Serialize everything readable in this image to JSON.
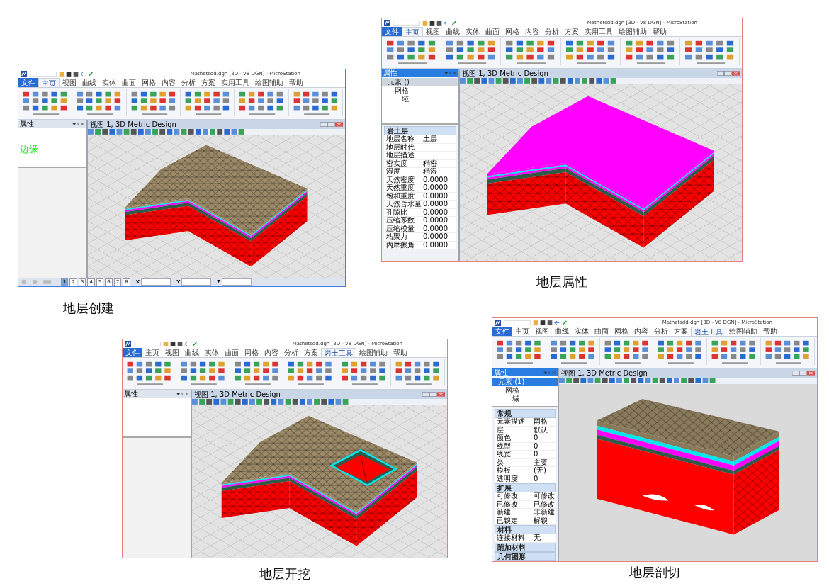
{
  "figures": [
    {
      "caption": "地层创建",
      "color": "#4a7de0",
      "window": {
        "title": "Mathetsdd.dgn [3D - V8 DGN] - MicroStation",
        "tabs": [
          {
            "label": "文件",
            "selected": false
          },
          {
            "label": "主页",
            "selected": true
          },
          {
            "label": "视图",
            "selected": false
          },
          {
            "label": "曲线",
            "selected": false
          },
          {
            "label": "实体",
            "selected": false
          },
          {
            "label": "曲面",
            "selected": false
          },
          {
            "label": "网格",
            "selected": false
          },
          {
            "label": "内容",
            "selected": false
          },
          {
            "label": "分析",
            "selected": false
          },
          {
            "label": "方案",
            "selected": false
          },
          {
            "label": "实用工具",
            "selected": false
          },
          {
            "label": "绘图辅助",
            "selected": false
          },
          {
            "label": "帮助",
            "selected": false
          }
        ],
        "sidebar": {
          "kind": "blank",
          "title": "属性",
          "edge_label": "边缘"
        },
        "view": {
          "title": "视图 1, 3D Metric Design",
          "kind": "build"
        },
        "status_bar": {
          "views": [
            {
              "label": "1",
              "selected": true
            },
            {
              "label": "2",
              "selected": false
            },
            {
              "label": "3",
              "selected": false
            },
            {
              "label": "4",
              "selected": false
            },
            {
              "label": "5",
              "selected": false
            },
            {
              "label": "6",
              "selected": false
            },
            {
              "label": "7",
              "selected": false
            },
            {
              "label": "8",
              "selected": false
            }
          ],
          "axes": [
            "X",
            "Y",
            "Z"
          ]
        }
      }
    },
    {
      "caption": "地层属性",
      "color": "#e88080",
      "window": {
        "title": "Mathetsdd.dgn [3D - V8 DGN] - MicroStation",
        "tabs": [
          {
            "label": "文件",
            "selected": false
          },
          {
            "label": "主页",
            "selected": true
          },
          {
            "label": "视图",
            "selected": false
          },
          {
            "label": "曲线",
            "selected": false
          },
          {
            "label": "实体",
            "selected": false
          },
          {
            "label": "曲面",
            "selected": false
          },
          {
            "label": "网格",
            "selected": false
          },
          {
            "label": "内容",
            "selected": false
          },
          {
            "label": "分析",
            "selected": false
          },
          {
            "label": "方案",
            "selected": false
          },
          {
            "label": "实用工具",
            "selected": false
          },
          {
            "label": "绘图辅助",
            "selected": false
          },
          {
            "label": "帮助",
            "selected": false
          }
        ],
        "sidebar": {
          "kind": "tree",
          "title": "属性",
          "tree": [
            {
              "label": "元素 ()",
              "selected": true,
              "children": [
                {
                  "label": "网格",
                  "selected": false,
                  "children": [
                    {
                      "label": "域",
                      "selected": false
                    }
                  ]
                }
              ]
            }
          ],
          "sections": [
            {
              "title": "岩土层",
              "expanded": true,
              "rows": [
                {
                  "label": "地层名称",
                  "value": "土层"
                },
                {
                  "label": "地层时代"
                },
                {
                  "label": "地层描述"
                },
                {
                  "label": "密实度",
                  "value": "稍密"
                },
                {
                  "label": "湿度",
                  "value": "稍湿"
                },
                {
                  "label": "天然密度",
                  "value": "0.0000"
                },
                {
                  "label": "天然重度",
                  "value": "0.0000"
                },
                {
                  "label": "饱和重度",
                  "value": "0.0000"
                },
                {
                  "label": "天然含水量",
                  "value": "0.0000"
                },
                {
                  "label": "孔隙比",
                  "value": "0.0000"
                },
                {
                  "label": "压缩系数",
                  "value": "0.0000"
                },
                {
                  "label": "压缩模量",
                  "value": "0.0000"
                },
                {
                  "label": "粘聚力",
                  "value": "0.0000"
                },
                {
                  "label": "内摩擦角",
                  "value": "0.0000"
                }
              ]
            }
          ]
        },
        "view": {
          "title": "视图 1, 3D Metric Design",
          "kind": "property"
        }
      }
    },
    {
      "caption": "地层开挖",
      "color": "#e88080",
      "window": {
        "title": "Mathetsdd.dgn [3D - V8 DGN] - MicroStation",
        "tabs": [
          {
            "label": "文件",
            "selected": false
          },
          {
            "label": "主页",
            "selected": false
          },
          {
            "label": "视图",
            "selected": false
          },
          {
            "label": "曲线",
            "selected": false
          },
          {
            "label": "实体",
            "selected": false
          },
          {
            "label": "曲面",
            "selected": false
          },
          {
            "label": "网格",
            "selected": false
          },
          {
            "label": "内容",
            "selected": false
          },
          {
            "label": "分析",
            "selected": false
          },
          {
            "label": "方案",
            "selected": false
          },
          {
            "label": "岩土工具",
            "selected": true
          },
          {
            "label": "绘图辅助",
            "selected": false
          },
          {
            "label": "帮助",
            "selected": false
          }
        ],
        "sidebar": {
          "kind": "blank",
          "title": "属性"
        },
        "view": {
          "title": "视图 1, 3D Metric Design",
          "kind": "excavation"
        }
      }
    },
    {
      "caption": "地层剖切",
      "color": "#e88080",
      "window": {
        "title": "Mathetsdd.dgn [3D - V8 DGN] - MicroStation",
        "tabs": [
          {
            "label": "文件",
            "selected": false
          },
          {
            "label": "主页",
            "selected": false
          },
          {
            "label": "视图",
            "selected": false
          },
          {
            "label": "曲线",
            "selected": false
          },
          {
            "label": "实体",
            "selected": false
          },
          {
            "label": "曲面",
            "selected": false
          },
          {
            "label": "网格",
            "selected": false
          },
          {
            "label": "内容",
            "selected": false
          },
          {
            "label": "分析",
            "selected": false
          },
          {
            "label": "方案",
            "selected": false
          },
          {
            "label": "岩土工具",
            "selected": true
          },
          {
            "label": "绘图辅助",
            "selected": false
          },
          {
            "label": "帮助",
            "selected": false
          }
        ],
        "sidebar": {
          "kind": "tree",
          "title": "属性",
          "tree": [
            {
              "label": "元素 (1)",
              "selected": true,
              "children": [
                {
                  "label": "网格",
                  "selected": false,
                  "children": [
                    {
                      "label": "域",
                      "selected": false
                    }
                  ]
                }
              ]
            }
          ],
          "sections": [
            {
              "title": "常规",
              "expanded": true,
              "rows": [
                {
                  "label": "元素描述",
                  "value": "网格"
                },
                {
                  "label": "层",
                  "value": "默认"
                },
                {
                  "label": "颜色",
                  "value": "0"
                },
                {
                  "label": "线型",
                  "value": "0"
                },
                {
                  "label": "线宽",
                  "value": "0"
                },
                {
                  "label": "类",
                  "value": "主要"
                },
                {
                  "label": "模板",
                  "value": "(无)"
                },
                {
                  "label": "透明度",
                  "value": "0"
                }
              ]
            },
            {
              "title": "扩展",
              "expanded": true,
              "rows": [
                {
                  "label": "可修改",
                  "value": "可修改"
                },
                {
                  "label": "已修改",
                  "value": "已修改"
                },
                {
                  "label": "新建",
                  "value": "非新建"
                },
                {
                  "label": "已锁定",
                  "value": "解锁"
                }
              ]
            },
            {
              "title": "材料",
              "expanded": true,
              "rows": [
                {
                  "label": "连接材料",
                  "value": "无"
                }
              ]
            },
            {
              "title": "附加材料",
              "expanded": false
            },
            {
              "title": "几何图形",
              "expanded": false
            }
          ]
        },
        "view": {
          "title": "视图 1, 3D Metric Design",
          "kind": "section"
        }
      }
    }
  ]
}
